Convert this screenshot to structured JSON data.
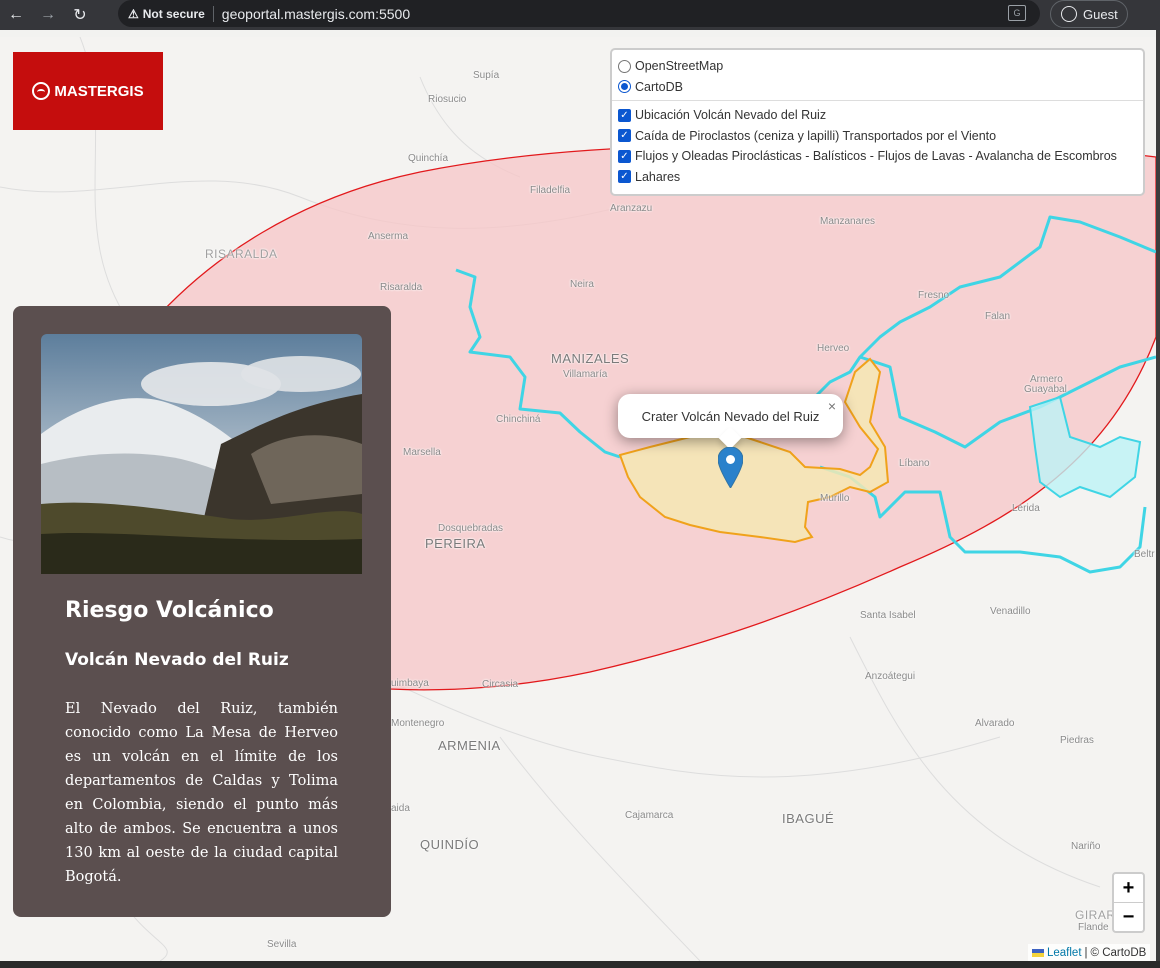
{
  "browser": {
    "security_label": "Not secure",
    "url": "geoportal.mastergis.com:5500",
    "profile_label": "Guest"
  },
  "logo": {
    "text": "MASTERGIS"
  },
  "layer_control": {
    "base_layers": [
      {
        "label": "OpenStreetMap",
        "selected": false
      },
      {
        "label": "CartoDB",
        "selected": true
      }
    ],
    "overlays": [
      {
        "label": "Ubicación Volcán Nevado del Ruiz",
        "checked": true
      },
      {
        "label": "Caída de Piroclastos (ceniza y lapilli) Transportados por el Viento",
        "checked": true
      },
      {
        "label": "Flujos y Oleadas Piroclásticas - Balísticos - Flujos de Lavas - Avalancha de Escombros",
        "checked": true
      },
      {
        "label": "Lahares",
        "checked": true
      }
    ]
  },
  "popup": {
    "text": "Crater Volcán Nevado del Ruiz",
    "close": "×"
  },
  "panel": {
    "title": "Riesgo Volcánico",
    "subtitle": "Volcán Nevado del Ruiz",
    "description": "El Nevado del Ruiz, también conocido como La Mesa de Herveo es un volcán en el límite de los departamentos de Caldas y Tolima en Colombia, siendo el punto más alto de ambos. Se encuentra a unos 130 km al oeste de la ciudad capital Bogotá."
  },
  "zoom": {
    "in": "+",
    "out": "−"
  },
  "attribution": {
    "leaflet": "Leaflet",
    "separator": "|",
    "carto": "© CartoDB"
  },
  "places": {
    "supia": "Supía",
    "riosucio": "Riosucio",
    "quinchia": "Quinchía",
    "filadelfia": "Filadelfia",
    "aranzazu": "Aranzazu",
    "manzanares": "Manzanares",
    "risaralda_dept": "RISARALDA",
    "anserma": "Anserma",
    "risaralda": "Risaralda",
    "neira": "Neira",
    "fresno": "Fresno",
    "falan": "Falan",
    "herveo": "Herveo",
    "manizales": "MANIZALES",
    "villamaria": "Villamaría",
    "armero": "Armero",
    "guayabal": "Guayabal",
    "chinchina": "Chinchiná",
    "marsella": "Marsella",
    "libano": "Líbano",
    "murillo": "Murillo",
    "lerida": "Lérida",
    "dosquebradas": "Dosquebradas",
    "pereira": "PEREIRA",
    "beltran": "Beltr",
    "venadillo": "Venadillo",
    "santa_isabel": "Santa Isabel",
    "anzoategui": "Anzoátegui",
    "quimbaya": "uimbaya",
    "circasia": "Circasia",
    "montenegro": "Montenegro",
    "alvarado": "Alvarado",
    "piedras": "Piedras",
    "armenia": "ARMENIA",
    "calarca": "aida",
    "cajamarca": "Cajamarca",
    "ibague": "IBAGUÉ",
    "quindio": "QUINDÍO",
    "narino": "Nariño",
    "girar": "GIRAR",
    "flande": "Flande",
    "sevilla": "Sevilla"
  },
  "colors": {
    "brand_red": "#c50d0d",
    "panel_bg": "#5b4f4f",
    "ash_fill": "#f7c5c7",
    "ash_stroke": "#e2191c",
    "pyroclastic_fill": "#f4e7b4",
    "pyroclastic_stroke": "#f0a21b",
    "lahar_stroke": "#3fd5e5",
    "marker": "#2a81cb"
  }
}
